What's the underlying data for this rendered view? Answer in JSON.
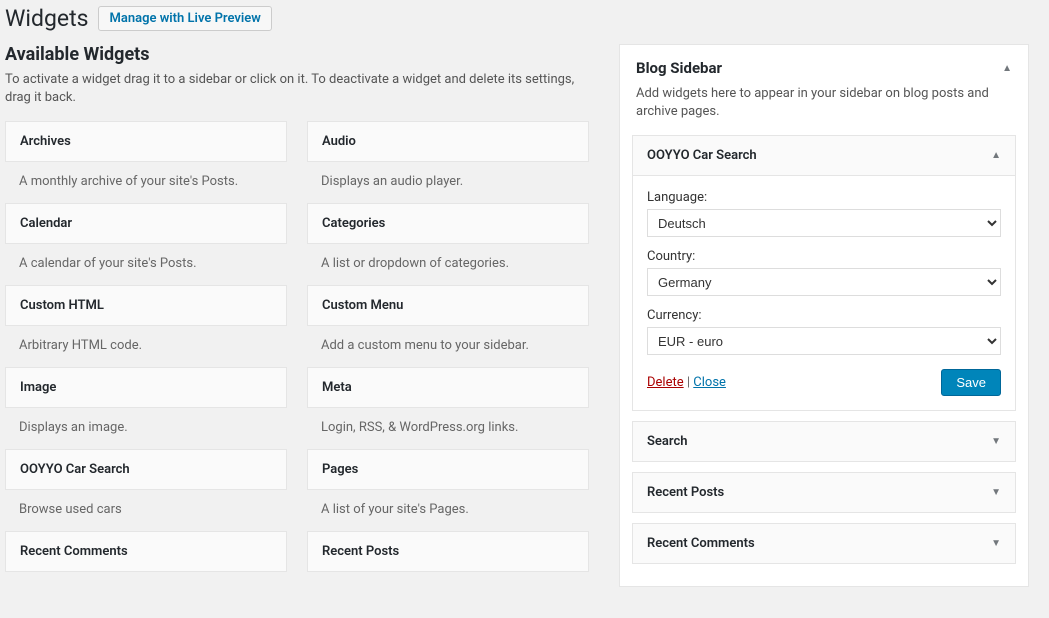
{
  "page": {
    "title": "Widgets",
    "manage_button": "Manage with Live Preview"
  },
  "available": {
    "heading": "Available Widgets",
    "description": "To activate a widget drag it to a sidebar or click on it. To deactivate a widget and delete its settings, drag it back.",
    "widgets": [
      {
        "title": "Archives",
        "desc": "A monthly archive of your site's Posts."
      },
      {
        "title": "Audio",
        "desc": "Displays an audio player."
      },
      {
        "title": "Calendar",
        "desc": "A calendar of your site's Posts."
      },
      {
        "title": "Categories",
        "desc": "A list or dropdown of categories."
      },
      {
        "title": "Custom HTML",
        "desc": "Arbitrary HTML code."
      },
      {
        "title": "Custom Menu",
        "desc": "Add a custom menu to your sidebar."
      },
      {
        "title": "Image",
        "desc": "Displays an image."
      },
      {
        "title": "Meta",
        "desc": "Login, RSS, & WordPress.org links."
      },
      {
        "title": "OOYYO Car Search",
        "desc": "Browse used cars"
      },
      {
        "title": "Pages",
        "desc": "A list of your site's Pages."
      },
      {
        "title": "Recent Comments",
        "desc": ""
      },
      {
        "title": "Recent Posts",
        "desc": ""
      }
    ]
  },
  "sidebar": {
    "title": "Blog Sidebar",
    "desc": "Add widgets here to appear in your sidebar on blog posts and archive pages.",
    "ooyyo": {
      "title": "OOYYO Car Search",
      "language_label": "Language:",
      "language_value": "Deutsch",
      "country_label": "Country:",
      "country_value": "Germany",
      "currency_label": "Currency:",
      "currency_value": "EUR - euro",
      "delete": "Delete",
      "close": "Close",
      "save": "Save"
    },
    "collapsed": [
      "Search",
      "Recent Posts",
      "Recent Comments"
    ]
  }
}
